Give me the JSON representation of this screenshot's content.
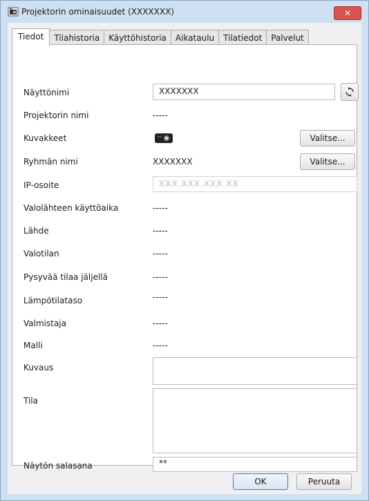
{
  "window": {
    "title": "Projektorin ominaisuudet (XXXXXXX)",
    "close_glyph": "✕"
  },
  "tabs": [
    {
      "label": "Tiedot",
      "active": true
    },
    {
      "label": "Tilahistoria",
      "active": false
    },
    {
      "label": "Käyttöhistoria",
      "active": false
    },
    {
      "label": "Aikataulu",
      "active": false
    },
    {
      "label": "Tilatiedot",
      "active": false
    },
    {
      "label": "Palvelut",
      "active": false
    }
  ],
  "fields": {
    "display_name": {
      "label": "Näyttönimi",
      "value": "XXXXXXX"
    },
    "projector_name": {
      "label": "Projektorin nimi",
      "value": "-----"
    },
    "icons": {
      "label": "Kuvakkeet",
      "button": "Valitse..."
    },
    "group_name": {
      "label": "Ryhmän nimi",
      "value": "XXXXXXX",
      "button": "Valitse..."
    },
    "ip_address": {
      "label": "IP-osoite",
      "value": "XXX.XXX.XXX.XX"
    },
    "light_source_time": {
      "label": "Valolähteen käyttöaika",
      "value": "-----"
    },
    "source": {
      "label": "Lähde",
      "value": "-----"
    },
    "light_mode": {
      "label": "Valotilan",
      "value": "-----"
    },
    "storage_remaining": {
      "label": "Pysyvää tilaa jäljellä",
      "value": "-----"
    },
    "temperature_level": {
      "label": "Lämpötilataso",
      "value": "-----"
    },
    "manufacturer": {
      "label": "Valmistaja",
      "value": "-----"
    },
    "model": {
      "label": "Malli",
      "value": "-----"
    },
    "description": {
      "label": "Kuvaus",
      "value": ""
    },
    "status": {
      "label": "Tila",
      "value": ""
    },
    "display_password": {
      "label": "Näytön salasana",
      "value": "**"
    }
  },
  "buttons": {
    "ok": "OK",
    "cancel": "Peruuta"
  },
  "colors": {
    "frame": "#cfe0f3",
    "close": "#d9534f",
    "ok_border": "#3c7fb1"
  }
}
